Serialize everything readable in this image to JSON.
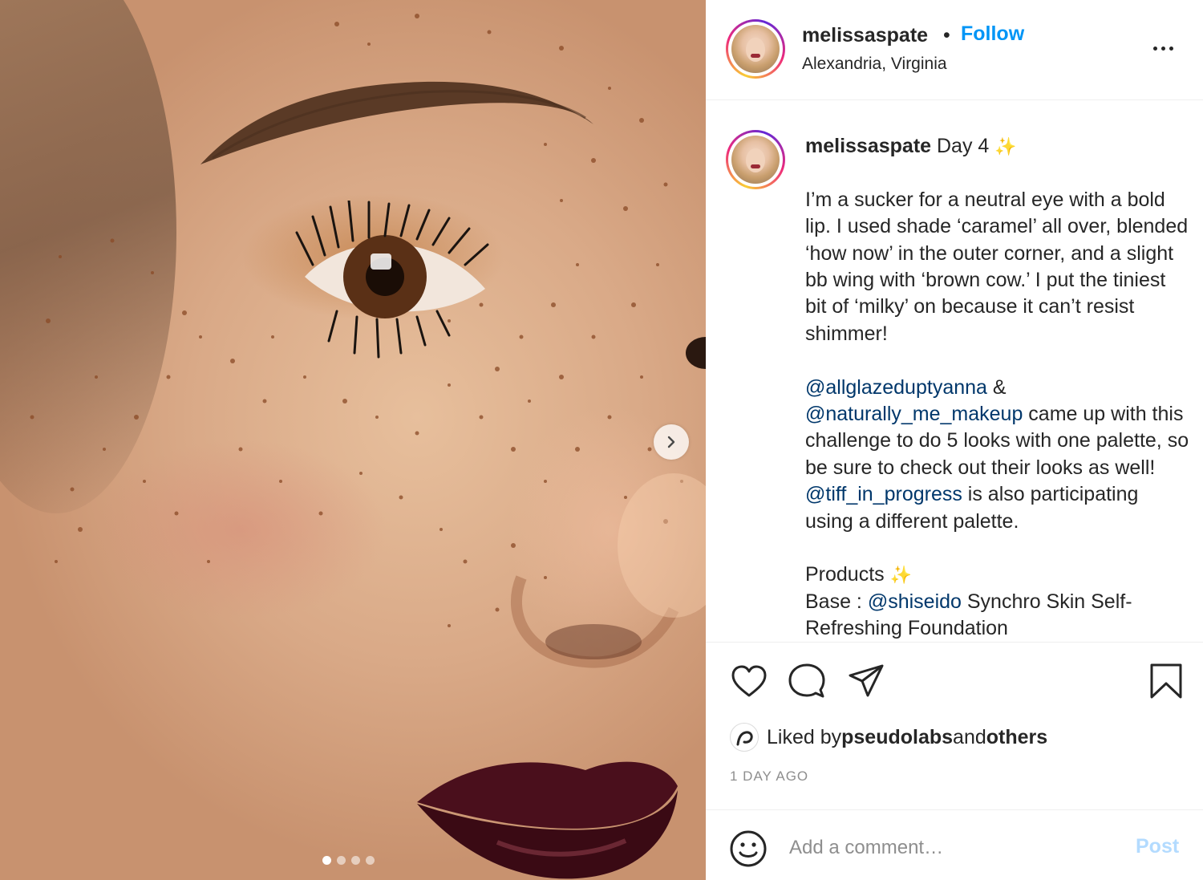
{
  "post": {
    "username": "melissaspate",
    "separator": "•",
    "follow_label": "Follow",
    "location": "Alexandria, Virginia"
  },
  "carousel": {
    "slide_count": 4,
    "active_index": 0
  },
  "caption": {
    "username": "melissaspate",
    "title": "Day 4",
    "spark": "✨",
    "p1": "I’m a sucker for a neutral eye with a bold lip. I used shade ‘caramel’ all over, blended ‘how now’ in the outer corner, and a slight bb wing with ‘brown cow.’ I put the tiniest bit of ‘milky’ on because it can’t resist shimmer!",
    "mention1": "@allglazeduptyanna",
    "amp": " &",
    "mention2": "@naturally_me_makeup",
    "p2_mid": " came up with this challenge to do 5 looks with one palette, so be sure to check out their looks as well! ",
    "mention3": "@tiff_in_progress",
    "p2_end": " is also participating using a different palette.",
    "products_label": "Products",
    "base_label": "Base : ",
    "mention4": "@shiseido",
    "base_text": " Synchro Skin Self-Refreshing Foundation"
  },
  "likes": {
    "prefix": "Liked by ",
    "user": "pseudolabs",
    "middle": " and ",
    "others": "others"
  },
  "timestamp": "1 DAY AGO",
  "comment_box": {
    "placeholder": "Add a comment…",
    "post_label": "Post"
  },
  "colors": {
    "follow_blue": "#0095f6",
    "mention_blue": "#00376b",
    "post_disabled": "#b3dbff",
    "muted": "#8e8e8e",
    "lip": "#4a0f1c"
  }
}
